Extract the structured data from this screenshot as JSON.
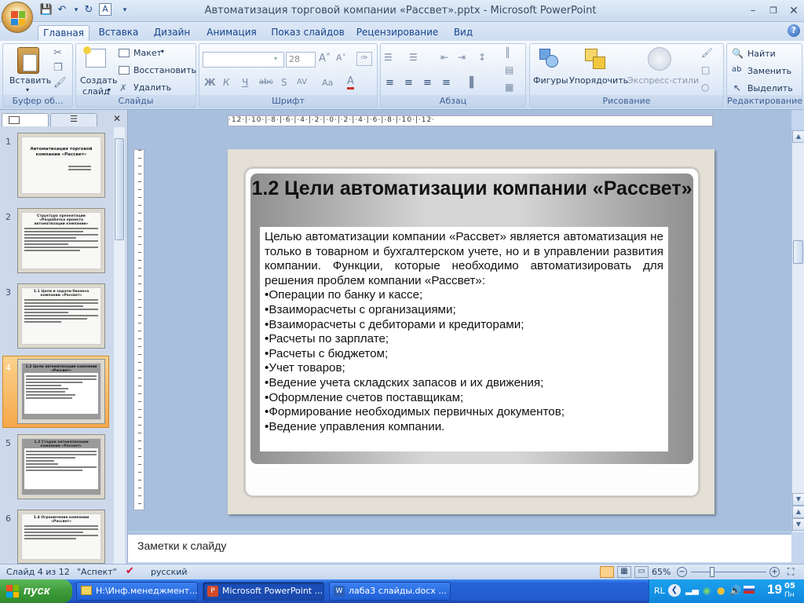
{
  "window": {
    "title": "Автоматизация торговой компании «Рассвет».pptx - Microsoft PowerPoint"
  },
  "ribbon_tabs": [
    "Главная",
    "Вставка",
    "Дизайн",
    "Анимация",
    "Показ слайдов",
    "Рецензирование",
    "Вид"
  ],
  "ribbon": {
    "clipboard": {
      "paste": "Вставить",
      "label": "Буфер об..."
    },
    "slides": {
      "new_slide_line1": "Создать",
      "new_slide_line2": "слайд",
      "layout": "Макет",
      "reset": "Восстановить",
      "delete": "Удалить",
      "label": "Слайды"
    },
    "font": {
      "size": "28",
      "label": "Шрифт"
    },
    "paragraph": {
      "label": "Абзац"
    },
    "drawing": {
      "shapes": "Фигуры",
      "arrange": "Упорядочить",
      "styles": "Экспресс-стили",
      "label": "Рисование"
    },
    "editing": {
      "find": "Найти",
      "replace": "Заменить",
      "select": "Выделить",
      "label": "Редактирование"
    }
  },
  "slide_numbers": [
    "1",
    "2",
    "3",
    "4",
    "5",
    "6"
  ],
  "thumbs": {
    "t1": "Автоматизация торговой компании «Рассвет»",
    "t2": "Структура презентации «Разработка проекта автоматизации компании»",
    "t3": "1.1 Цели и задачи бизнеса компании «Рассвет»",
    "t4": "1.2 Цели автоматизации компании «Рассвет»",
    "t5": "1.3 Стадии автоматизации компании «Рассвет»",
    "t6": "1.4 Ограничения компании «Рассвет»"
  },
  "ruler": "·12·|·10·|·8·|·6·|·4·|·2·|·0·|·2·|·4·|·6·|·8·|·10·|·12·",
  "slide": {
    "title": "1.2 Цели автоматизации компании «Рассвет»",
    "intro": "Целью автоматизации компании «Рассвет» является автоматизация не только в товарном и бухгалтерском учете, но и в управлении развития компании. Функции, которые необходимо автоматизировать для решения проблем компании «Рассвет»:",
    "bullets": [
      "•Операции по банку и кассе;",
      "•Взаиморасчеты с организациями;",
      "•Взаиморасчеты с дебиторами и кредиторами;",
      "•Расчеты по зарплате;",
      "•Расчеты с бюджетом;",
      "•Учет товаров;",
      "•Ведение учета складских запасов и их движения;",
      "•Оформление счетов поставщикам;",
      "•Формирование необходимых первичных документов;",
      "•Ведение управления компании."
    ]
  },
  "notes_placeholder": "Заметки к слайду",
  "status": {
    "slide": "Слайд 4 из 12",
    "theme": "\"Аспект\"",
    "language": "русский",
    "zoom": "65%"
  },
  "taskbar": {
    "start": "пуск",
    "items": [
      "H:\\Инф.менеджмент...",
      "Microsoft PowerPoint ...",
      "лаба3 слайды.docx ..."
    ],
    "lang": "RL",
    "time": "19",
    "time_small": "05",
    "day": "Пн"
  },
  "colors": {
    "accent": "#15428b",
    "ribbon_bg": "#dbe6f5",
    "taskbar": "#235bd0",
    "selection": "#f6a84a"
  }
}
